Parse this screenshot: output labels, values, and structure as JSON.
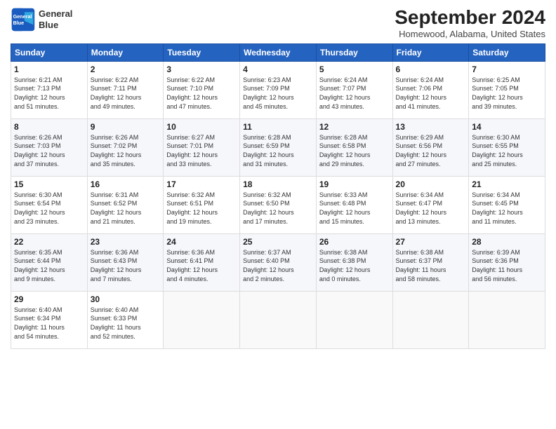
{
  "header": {
    "logo_line1": "General",
    "logo_line2": "Blue",
    "month": "September 2024",
    "location": "Homewood, Alabama, United States"
  },
  "weekdays": [
    "Sunday",
    "Monday",
    "Tuesday",
    "Wednesday",
    "Thursday",
    "Friday",
    "Saturday"
  ],
  "weeks": [
    [
      {
        "day": "1",
        "sunrise": "6:21 AM",
        "sunset": "7:13 PM",
        "daylight": "12 hours and 51 minutes."
      },
      {
        "day": "2",
        "sunrise": "6:22 AM",
        "sunset": "7:11 PM",
        "daylight": "12 hours and 49 minutes."
      },
      {
        "day": "3",
        "sunrise": "6:22 AM",
        "sunset": "7:10 PM",
        "daylight": "12 hours and 47 minutes."
      },
      {
        "day": "4",
        "sunrise": "6:23 AM",
        "sunset": "7:09 PM",
        "daylight": "12 hours and 45 minutes."
      },
      {
        "day": "5",
        "sunrise": "6:24 AM",
        "sunset": "7:07 PM",
        "daylight": "12 hours and 43 minutes."
      },
      {
        "day": "6",
        "sunrise": "6:24 AM",
        "sunset": "7:06 PM",
        "daylight": "12 hours and 41 minutes."
      },
      {
        "day": "7",
        "sunrise": "6:25 AM",
        "sunset": "7:05 PM",
        "daylight": "12 hours and 39 minutes."
      }
    ],
    [
      {
        "day": "8",
        "sunrise": "6:26 AM",
        "sunset": "7:03 PM",
        "daylight": "12 hours and 37 minutes."
      },
      {
        "day": "9",
        "sunrise": "6:26 AM",
        "sunset": "7:02 PM",
        "daylight": "12 hours and 35 minutes."
      },
      {
        "day": "10",
        "sunrise": "6:27 AM",
        "sunset": "7:01 PM",
        "daylight": "12 hours and 33 minutes."
      },
      {
        "day": "11",
        "sunrise": "6:28 AM",
        "sunset": "6:59 PM",
        "daylight": "12 hours and 31 minutes."
      },
      {
        "day": "12",
        "sunrise": "6:28 AM",
        "sunset": "6:58 PM",
        "daylight": "12 hours and 29 minutes."
      },
      {
        "day": "13",
        "sunrise": "6:29 AM",
        "sunset": "6:56 PM",
        "daylight": "12 hours and 27 minutes."
      },
      {
        "day": "14",
        "sunrise": "6:30 AM",
        "sunset": "6:55 PM",
        "daylight": "12 hours and 25 minutes."
      }
    ],
    [
      {
        "day": "15",
        "sunrise": "6:30 AM",
        "sunset": "6:54 PM",
        "daylight": "12 hours and 23 minutes."
      },
      {
        "day": "16",
        "sunrise": "6:31 AM",
        "sunset": "6:52 PM",
        "daylight": "12 hours and 21 minutes."
      },
      {
        "day": "17",
        "sunrise": "6:32 AM",
        "sunset": "6:51 PM",
        "daylight": "12 hours and 19 minutes."
      },
      {
        "day": "18",
        "sunrise": "6:32 AM",
        "sunset": "6:50 PM",
        "daylight": "12 hours and 17 minutes."
      },
      {
        "day": "19",
        "sunrise": "6:33 AM",
        "sunset": "6:48 PM",
        "daylight": "12 hours and 15 minutes."
      },
      {
        "day": "20",
        "sunrise": "6:34 AM",
        "sunset": "6:47 PM",
        "daylight": "12 hours and 13 minutes."
      },
      {
        "day": "21",
        "sunrise": "6:34 AM",
        "sunset": "6:45 PM",
        "daylight": "12 hours and 11 minutes."
      }
    ],
    [
      {
        "day": "22",
        "sunrise": "6:35 AM",
        "sunset": "6:44 PM",
        "daylight": "12 hours and 9 minutes."
      },
      {
        "day": "23",
        "sunrise": "6:36 AM",
        "sunset": "6:43 PM",
        "daylight": "12 hours and 7 minutes."
      },
      {
        "day": "24",
        "sunrise": "6:36 AM",
        "sunset": "6:41 PM",
        "daylight": "12 hours and 4 minutes."
      },
      {
        "day": "25",
        "sunrise": "6:37 AM",
        "sunset": "6:40 PM",
        "daylight": "12 hours and 2 minutes."
      },
      {
        "day": "26",
        "sunrise": "6:38 AM",
        "sunset": "6:38 PM",
        "daylight": "12 hours and 0 minutes."
      },
      {
        "day": "27",
        "sunrise": "6:38 AM",
        "sunset": "6:37 PM",
        "daylight": "11 hours and 58 minutes."
      },
      {
        "day": "28",
        "sunrise": "6:39 AM",
        "sunset": "6:36 PM",
        "daylight": "11 hours and 56 minutes."
      }
    ],
    [
      {
        "day": "29",
        "sunrise": "6:40 AM",
        "sunset": "6:34 PM",
        "daylight": "11 hours and 54 minutes."
      },
      {
        "day": "30",
        "sunrise": "6:40 AM",
        "sunset": "6:33 PM",
        "daylight": "11 hours and 52 minutes."
      },
      null,
      null,
      null,
      null,
      null
    ]
  ]
}
